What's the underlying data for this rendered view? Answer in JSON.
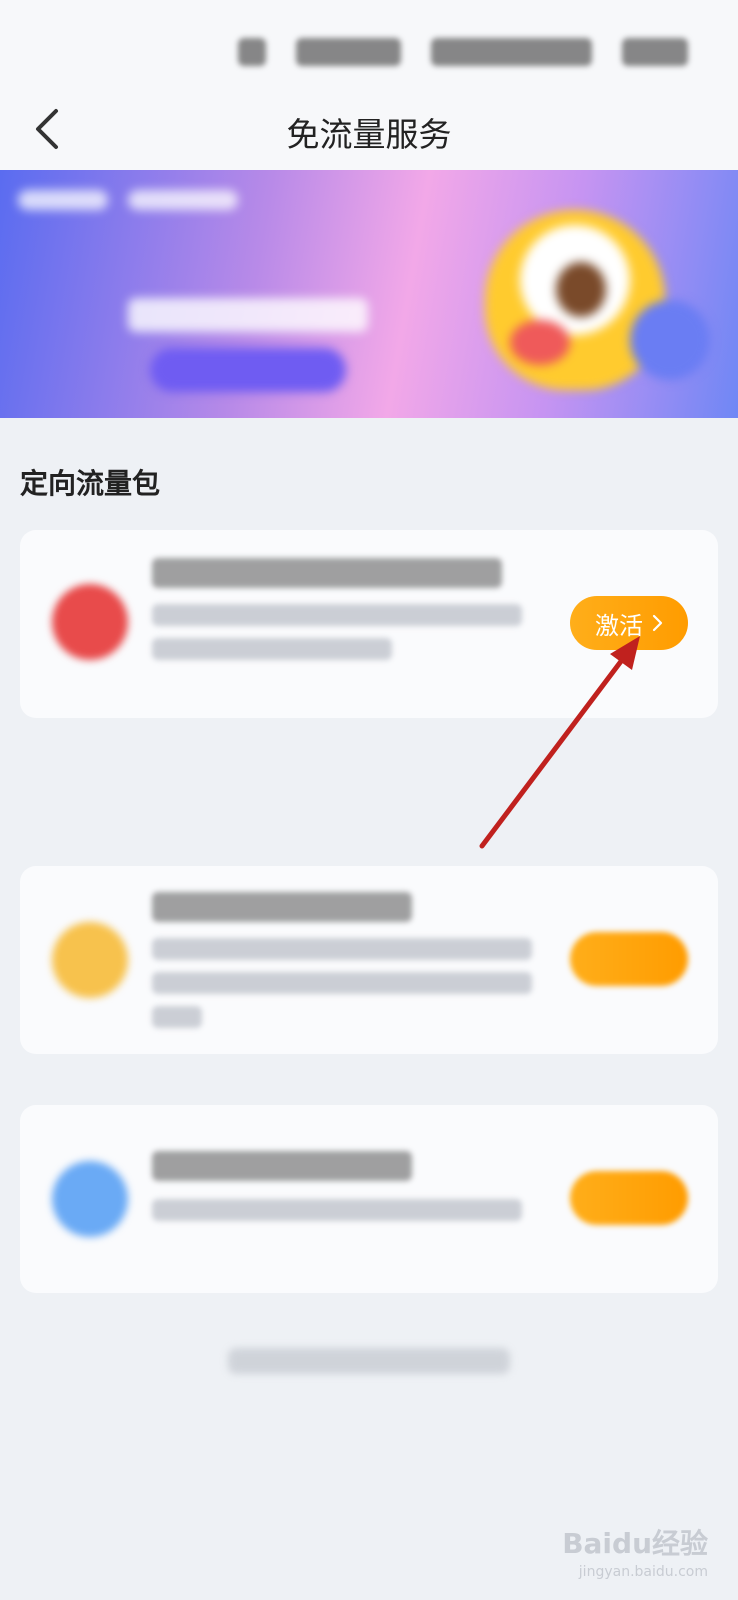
{
  "header": {
    "title": "免流量服务",
    "back_icon": "chevron-left-icon"
  },
  "sections": {
    "directed_package": "定向流量包"
  },
  "cards": {
    "card1": {
      "button_label": "激活"
    }
  },
  "watermark": {
    "brand": "Baidu经验",
    "url": "jingyan.baidu.com"
  },
  "colors": {
    "accent": "#ffa10a",
    "arrow": "#c0211e"
  }
}
